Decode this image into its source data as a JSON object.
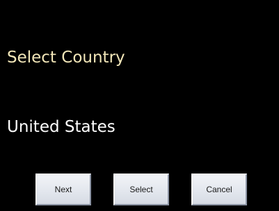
{
  "screen": {
    "prompt": "Select Country",
    "current_value": "United States"
  },
  "buttons": {
    "next_label": "Next",
    "select_label": "Select",
    "cancel_label": "Cancel"
  },
  "colors": {
    "background": "#000000",
    "prompt_text": "#f2e6b8",
    "value_text": "#ffffff",
    "button_face": "#e3e7ee"
  }
}
